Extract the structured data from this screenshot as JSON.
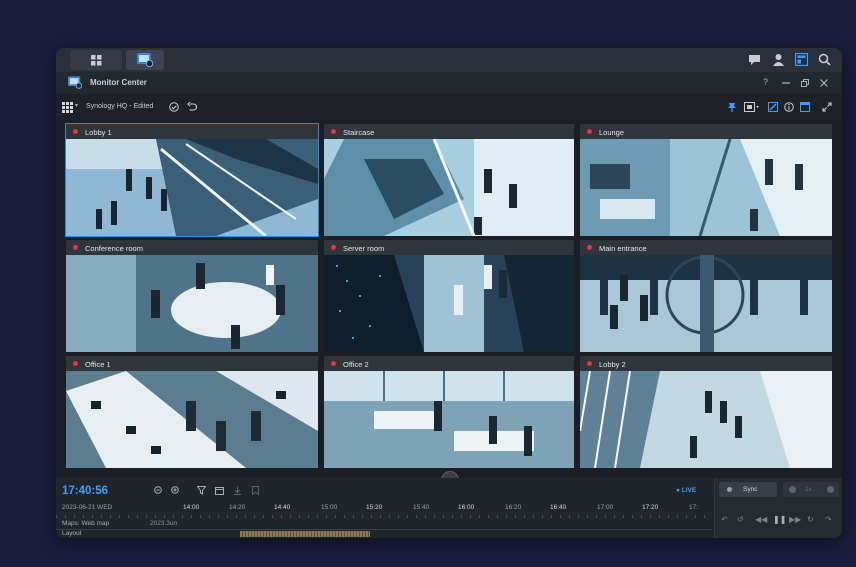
{
  "window": {
    "title": "Monitor Center"
  },
  "toolbar": {
    "layout_name": "Synology HQ - Edited"
  },
  "cameras": [
    {
      "name": "Lobby 1"
    },
    {
      "name": "Staircase"
    },
    {
      "name": "Lounge"
    },
    {
      "name": "Conference room"
    },
    {
      "name": "Server room"
    },
    {
      "name": "Main entrance"
    },
    {
      "name": "Office 1"
    },
    {
      "name": "Office 2"
    },
    {
      "name": "Lobby 2"
    }
  ],
  "timeline": {
    "clock": "17:40:56",
    "date": "2023-06-21 WED",
    "live_label": "● LIVE",
    "ticks": [
      "14:00",
      "14:20",
      "14:40",
      "15:00",
      "15:20",
      "15:40",
      "16:00",
      "16:20",
      "16:40",
      "17:00",
      "17:20",
      "17:"
    ],
    "tracks": [
      {
        "label": "Maps: Web map",
        "note": "2023.3un"
      },
      {
        "label": "Layout"
      }
    ]
  },
  "playback": {
    "sync_label": "Sync",
    "speed_label": "1x"
  },
  "colors": {
    "accent": "#3aa0ff",
    "selected_border": "#2f8bd8",
    "rec_dot": "#e03a3a"
  }
}
